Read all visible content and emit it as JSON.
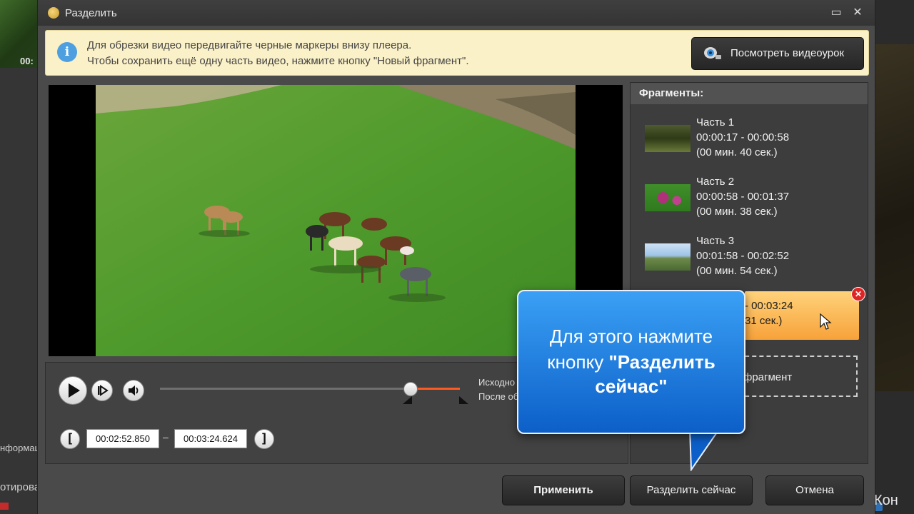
{
  "background_app": {
    "thumb_time": "00:",
    "info_label": "нформац",
    "edit_label": "отирова",
    "right_bottom": "Кон"
  },
  "window": {
    "title": "Разделить",
    "minimize_glyph": "▭",
    "close_glyph": "✕"
  },
  "infobar": {
    "icon_glyph": "i",
    "line1": "Для обрезки видео передвигайте черные маркеры внизу плеера.",
    "line2": "Чтобы сохранить ещё одну часть видео, нажмите кнопку \"Новый фрагмент\".",
    "tutorial_label": "Посмотреть видеоурок"
  },
  "player": {
    "source_label": "Исходно",
    "after_label": "После об",
    "start_time": "00:02:52.850",
    "end_time": "00:03:24.624",
    "dash": "–",
    "bracket_left": "[",
    "bracket_right": "]",
    "position_fraction": 0.76,
    "selection_start_fraction": 0.76,
    "selection_end_fraction": 0.9
  },
  "fragments": {
    "header": "Фрагменты:",
    "items": [
      {
        "name": "Часть 1",
        "range": "00:00:17 - 00:00:58",
        "duration": "(00 мин. 40 сек.)"
      },
      {
        "name": "Часть 2",
        "range": "00:00:58 - 00:01:37",
        "duration": "(00 мин. 38 сек.)"
      },
      {
        "name": "Часть 3",
        "range": "00:01:58 - 00:02:52",
        "duration": "(00 мин. 54 сек.)"
      }
    ],
    "selected": {
      "range": "- 00:03:24",
      "duration": "31 сек.)"
    },
    "close_glyph": "✕",
    "new_fragment_label": "фрагмент"
  },
  "callout": {
    "line1": "Для этого нажмите",
    "line2_prefix": "кнопку ",
    "line2_bold": "\"Разделить",
    "line3_bold": "сейчас\""
  },
  "buttons": {
    "apply": "Применить",
    "split_now": "Разделить сейчас",
    "cancel": "Отмена"
  },
  "colors": {
    "accent_orange": "#ff5a1f",
    "selected_fragment": "#f7a23a",
    "callout_blue": "#0c5fc8",
    "info_bg": "#fbf1c8"
  }
}
